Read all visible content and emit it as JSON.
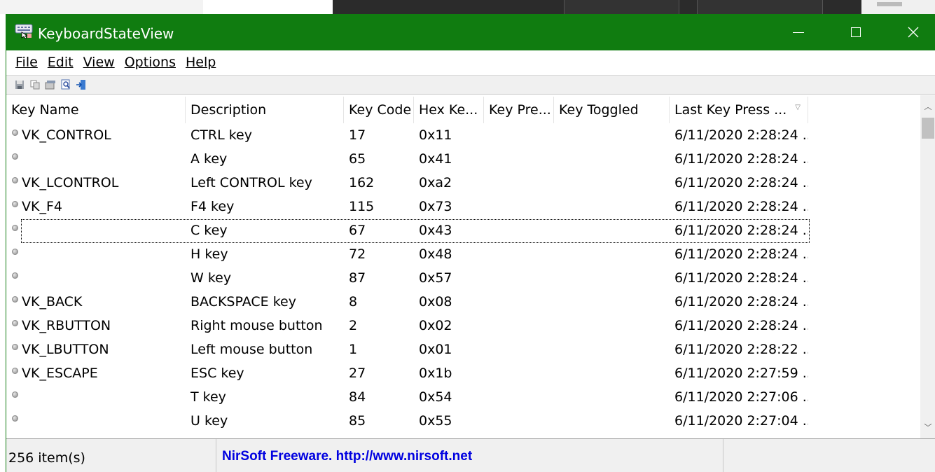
{
  "window": {
    "title": "KeyboardStateView",
    "colors": {
      "titlebar": "#107c10",
      "link": "#0000e0"
    }
  },
  "menu": [
    {
      "label": "File"
    },
    {
      "label": "Edit"
    },
    {
      "label": "View"
    },
    {
      "label": "Options"
    },
    {
      "label": "Help"
    }
  ],
  "toolbar": {
    "buttons": [
      "save-icon",
      "copy-icon",
      "properties-icon",
      "find-icon",
      "exit-icon"
    ]
  },
  "columns": [
    {
      "label": "Key Name"
    },
    {
      "label": "Description"
    },
    {
      "label": "Key Code"
    },
    {
      "label": "Hex Ke..."
    },
    {
      "label": "Key Pre..."
    },
    {
      "label": "Key Toggled"
    },
    {
      "label": "Last Key Press ..."
    }
  ],
  "rows": [
    {
      "key_name": "VK_CONTROL",
      "description": "CTRL key",
      "key_code": "17",
      "hex": "0x11",
      "pressed": "",
      "toggled": "",
      "last_press": "6/11/2020 2:28:24 ..."
    },
    {
      "key_name": "",
      "description": "A key",
      "key_code": "65",
      "hex": "0x41",
      "pressed": "",
      "toggled": "",
      "last_press": "6/11/2020 2:28:24 ..."
    },
    {
      "key_name": "VK_LCONTROL",
      "description": "Left CONTROL key",
      "key_code": "162",
      "hex": "0xa2",
      "pressed": "",
      "toggled": "",
      "last_press": "6/11/2020 2:28:24 ..."
    },
    {
      "key_name": "VK_F4",
      "description": "F4 key",
      "key_code": "115",
      "hex": "0x73",
      "pressed": "",
      "toggled": "",
      "last_press": "6/11/2020 2:28:24 ..."
    },
    {
      "key_name": "",
      "description": "C key",
      "key_code": "67",
      "hex": "0x43",
      "pressed": "",
      "toggled": "",
      "last_press": "6/11/2020 2:28:24 ..."
    },
    {
      "key_name": "",
      "description": "H key",
      "key_code": "72",
      "hex": "0x48",
      "pressed": "",
      "toggled": "",
      "last_press": "6/11/2020 2:28:24 ..."
    },
    {
      "key_name": "",
      "description": "W key",
      "key_code": "87",
      "hex": "0x57",
      "pressed": "",
      "toggled": "",
      "last_press": "6/11/2020 2:28:24 ..."
    },
    {
      "key_name": "VK_BACK",
      "description": "BACKSPACE key",
      "key_code": "8",
      "hex": "0x08",
      "pressed": "",
      "toggled": "",
      "last_press": "6/11/2020 2:28:24 ..."
    },
    {
      "key_name": "VK_RBUTTON",
      "description": "Right mouse button",
      "key_code": "2",
      "hex": "0x02",
      "pressed": "",
      "toggled": "",
      "last_press": "6/11/2020 2:28:24 ..."
    },
    {
      "key_name": "VK_LBUTTON",
      "description": "Left mouse button",
      "key_code": "1",
      "hex": "0x01",
      "pressed": "",
      "toggled": "",
      "last_press": "6/11/2020 2:28:22 ..."
    },
    {
      "key_name": "VK_ESCAPE",
      "description": "ESC key",
      "key_code": "27",
      "hex": "0x1b",
      "pressed": "",
      "toggled": "",
      "last_press": "6/11/2020 2:27:59 ..."
    },
    {
      "key_name": "",
      "description": "T key",
      "key_code": "84",
      "hex": "0x54",
      "pressed": "",
      "toggled": "",
      "last_press": "6/11/2020 2:27:06 ..."
    },
    {
      "key_name": "",
      "description": "U key",
      "key_code": "85",
      "hex": "0x55",
      "pressed": "",
      "toggled": "",
      "last_press": "6/11/2020 2:27:04 ..."
    }
  ],
  "status": {
    "count": "256 item(s)",
    "link": "NirSoft Freeware.  http://www.nirsoft.net"
  }
}
